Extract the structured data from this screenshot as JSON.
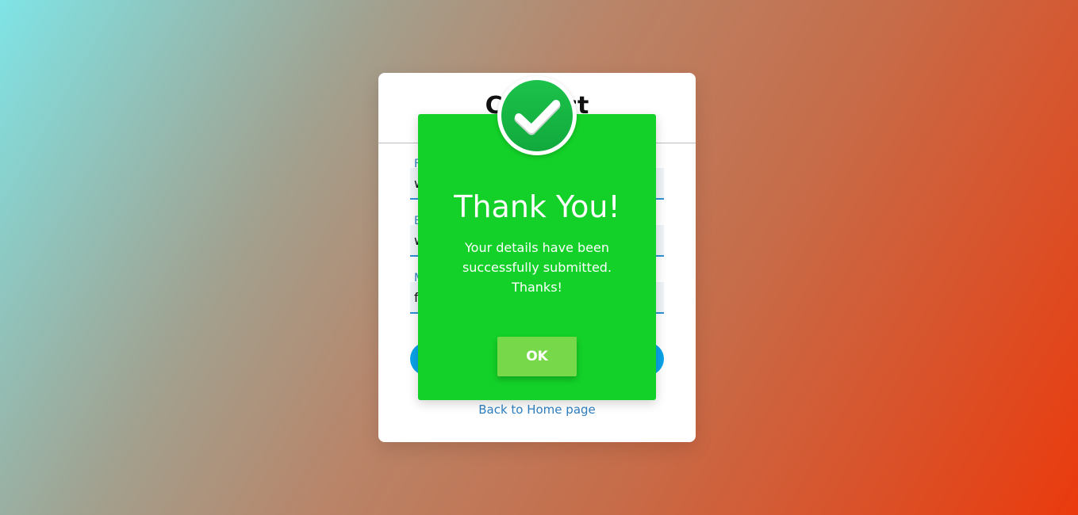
{
  "contact_form": {
    "title": "Contact",
    "fields": [
      {
        "label": "F",
        "value": "w"
      },
      {
        "label": "E",
        "value": "w"
      },
      {
        "label": "M",
        "value": "f"
      }
    ],
    "submit_label": "",
    "home_link_label": "Back to Home page"
  },
  "popup": {
    "title": "Thank You!",
    "message": "Your details have been successfully submitted. Thanks!",
    "ok_label": "OK",
    "icon": "check-circle-icon",
    "colors": {
      "background": "#13d128",
      "ok_button": "#77d94a",
      "badge": "#12a93d"
    }
  }
}
